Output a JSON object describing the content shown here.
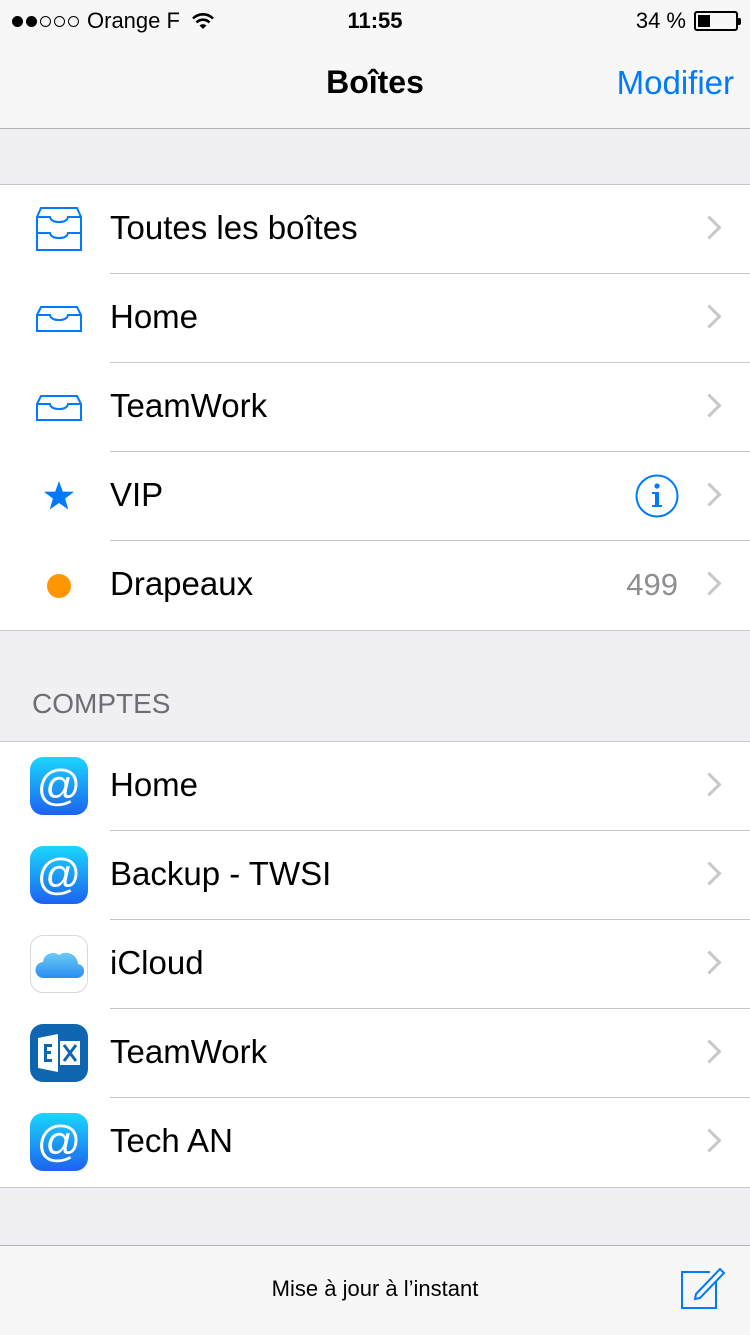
{
  "status_bar": {
    "carrier": "Orange F",
    "time": "11:55",
    "battery_text": "34 %",
    "battery_level": 0.34,
    "signal_bars_filled": 2,
    "signal_bars_total": 5
  },
  "nav": {
    "title": "Boîtes",
    "edit_label": "Modifier"
  },
  "mailboxes": [
    {
      "label": "Toutes les boîtes",
      "icon": "all-inboxes-icon"
    },
    {
      "label": "Home",
      "icon": "inbox-icon"
    },
    {
      "label": "TeamWork",
      "icon": "inbox-icon"
    },
    {
      "label": "VIP",
      "icon": "star-icon"
    },
    {
      "label": "Drapeaux",
      "icon": "flag-dot-icon",
      "count": "499"
    }
  ],
  "accounts_header": "COMPTES",
  "accounts": [
    {
      "label": "Home",
      "icon": "at-mail-icon"
    },
    {
      "label": "Backup - TWSI",
      "icon": "at-mail-icon"
    },
    {
      "label": "iCloud",
      "icon": "icloud-icon"
    },
    {
      "label": "TeamWork",
      "icon": "exchange-icon"
    },
    {
      "label": "Tech AN",
      "icon": "at-mail-icon"
    }
  ],
  "toolbar": {
    "status": "Mise à jour à l’instant"
  },
  "colors": {
    "accent": "#007aff",
    "flag": "#ff9500",
    "background": "#efeff4"
  }
}
